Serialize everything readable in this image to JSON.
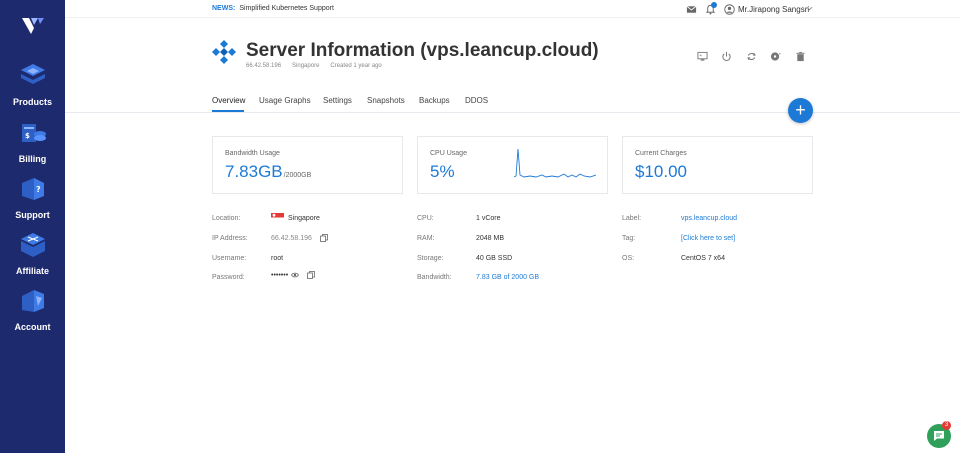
{
  "sidebar": {
    "items": [
      {
        "label": "Products"
      },
      {
        "label": "Billing"
      },
      {
        "label": "Support"
      },
      {
        "label": "Affiliate"
      },
      {
        "label": "Account"
      }
    ]
  },
  "topbar": {
    "news_tag": "NEWS:",
    "news_text": "Simplified Kubernetes Support",
    "user_name": "Mr.Jirapong Sangsri"
  },
  "header": {
    "title": "Server Information (vps.leancup.cloud)",
    "ip": "66.42.58.196",
    "location": "Singapore",
    "created": "Created 1 year ago"
  },
  "tabs": [
    "Overview",
    "Usage Graphs",
    "Settings",
    "Snapshots",
    "Backups",
    "DDOS"
  ],
  "fab_label": "+",
  "cards": {
    "bandwidth": {
      "label": "Bandwidth Usage",
      "value": "7.83GB",
      "unit": "/2000GB"
    },
    "cpu": {
      "label": "CPU Usage",
      "value": "5%"
    },
    "charges": {
      "label": "Current Charges",
      "value": "$10.00"
    }
  },
  "details": {
    "col1": [
      {
        "label": "Location:",
        "value": "Singapore"
      },
      {
        "label": "IP Address:",
        "value": "66.42.58.196"
      },
      {
        "label": "Username:",
        "value": "root"
      },
      {
        "label": "Password:",
        "value": "•••••••"
      }
    ],
    "col2": [
      {
        "label": "CPU:",
        "value": "1 vCore"
      },
      {
        "label": "RAM:",
        "value": "2048 MB"
      },
      {
        "label": "Storage:",
        "value": "40 GB SSD"
      },
      {
        "label": "Bandwidth:",
        "value": "7.83 GB of 2000 GB"
      }
    ],
    "col3": [
      {
        "label": "Label:",
        "value": "vps.leancup.cloud"
      },
      {
        "label": "Tag:",
        "value": "[Click here to set]"
      },
      {
        "label": "OS:",
        "value": "CentOS 7 x64"
      }
    ]
  },
  "chat_badge": "3",
  "colors": {
    "sidebar": "#1e2a6e",
    "accent": "#1c7ad6",
    "chat": "#2ea05a",
    "badge": "#e53935"
  }
}
